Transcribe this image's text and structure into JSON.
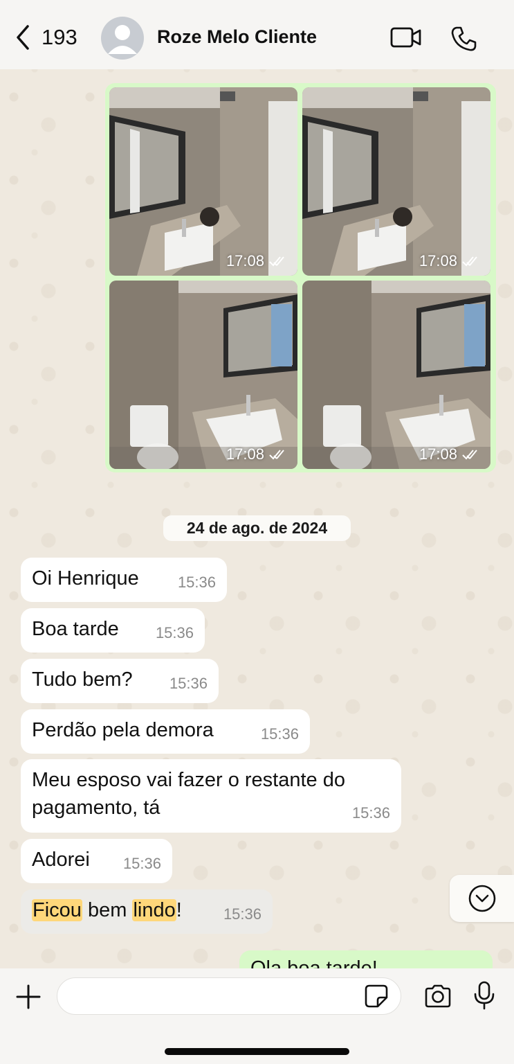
{
  "header": {
    "back_count": "193",
    "contact_name": "Roze Melo Cliente"
  },
  "photos": [
    {
      "time": "17:08",
      "kind": "mirror"
    },
    {
      "time": "17:08",
      "kind": "mirror"
    },
    {
      "time": "17:08",
      "kind": "toilet"
    },
    {
      "time": "17:08",
      "kind": "toilet"
    }
  ],
  "date_separator": "24 de ago. de 2024",
  "messages": [
    {
      "text": "Oi Henrique",
      "time": "15:36"
    },
    {
      "text": "Boa tarde",
      "time": "15:36"
    },
    {
      "text": "Tudo bem?",
      "time": "15:36"
    },
    {
      "text": "Perdão pela demora",
      "time": "15:36"
    },
    {
      "text": "Meu esposo vai fazer o restante do pagamento, tá",
      "time": "15:36"
    },
    {
      "text": "Adorei",
      "time": "15:36"
    },
    {
      "text_parts": [
        "Ficou",
        " bem ",
        "lindo",
        "!"
      ],
      "time": "15:36"
    }
  ],
  "outgoing_partial": "Ola boa tarde!",
  "composer": {
    "value": "",
    "placeholder": ""
  },
  "colors": {
    "incoming_bubble": "#ffffff",
    "outgoing_bubble": "#d8f9c8",
    "highlight": "#ffd77a",
    "chat_background": "#efe9df"
  },
  "icons": [
    "back-chevron-icon",
    "avatar-icon",
    "video-call-icon",
    "phone-icon",
    "checkmarks-icon",
    "scroll-down-icon",
    "plus-icon",
    "sticker-icon",
    "camera-icon",
    "microphone-icon"
  ]
}
